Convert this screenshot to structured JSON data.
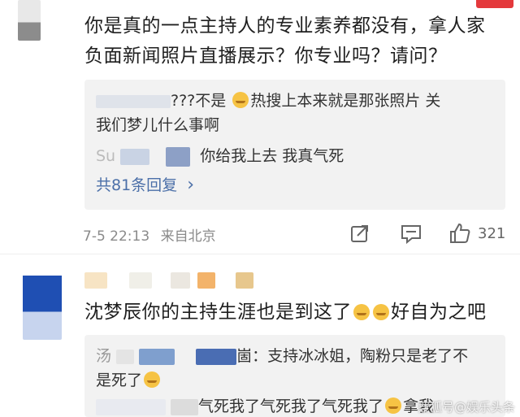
{
  "comment1": {
    "text_line1": "你是真的一点主持人的专业素养都没有，拿人家",
    "text_line2": "负面新闻照片直播展示？你专业吗？请问？",
    "replies": {
      "r1_suffix": "???不是",
      "r1_rest": "热搜上本来就是那张照片 关",
      "r1_line2": "我们梦儿什么事啊",
      "r2_prefix": "Su",
      "r2_text": "你给我上去 我真气死"
    },
    "more_label": "共81条回复",
    "more_chevron": "›",
    "date": "7-5 22:13",
    "location": "来自北京",
    "like_count": "321"
  },
  "comment2": {
    "text": "沈梦辰你的主持生涯也是到这了",
    "text_tail": "好自为之吧",
    "replies": {
      "r1_prefix": "汤",
      "r1_colon": "崮：",
      "r1_text": "支持冰冰姐，陶粉只是老了不",
      "r1_line2": "是死了",
      "r2_text": "气死我了气死我了气死我了",
      "r2_tail": "拿我"
    }
  },
  "watermark": "搜狐号@娱乐头条"
}
